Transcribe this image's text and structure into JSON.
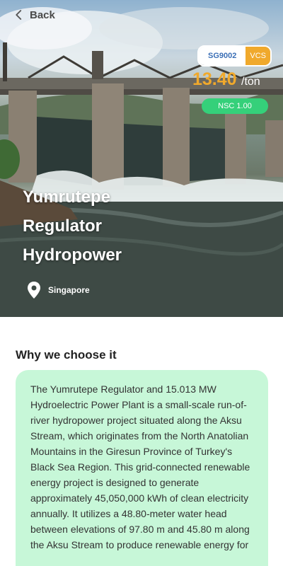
{
  "header": {
    "back_label": "Back"
  },
  "project": {
    "code": "SG9002",
    "standard": "VCS",
    "price": "13.40",
    "price_unit": "/ton",
    "nsc": "NSC 1.00",
    "title": "Yumrutepe Regulator Hydropower",
    "location": "Singapore"
  },
  "section": {
    "title": "Why we choose it",
    "description": "The Yumrutepe Regulator and 15.013 MW Hydroelectric Power Plant is a small-scale run-of-river hydropower project situated along the Aksu Stream, which originates from the North Anatolian Mountains in the Giresun Province of Turkey's Black Sea Region. This grid-connected renewable energy project is designed to generate approximately 45,050,000 kWh of clean electricity annually. It utilizes a 48.80-meter water head between elevations of 97.80 m and 45.80 m along the Aksu Stream to produce renewable energy for"
  },
  "colors": {
    "accent": "#f0a92c",
    "badge_green": "#35d07a",
    "card_bg": "#c7f7d8",
    "code_blue": "#3b6fb6"
  },
  "icons": {
    "back": "chevron-left-icon",
    "location": "map-pin-icon"
  }
}
